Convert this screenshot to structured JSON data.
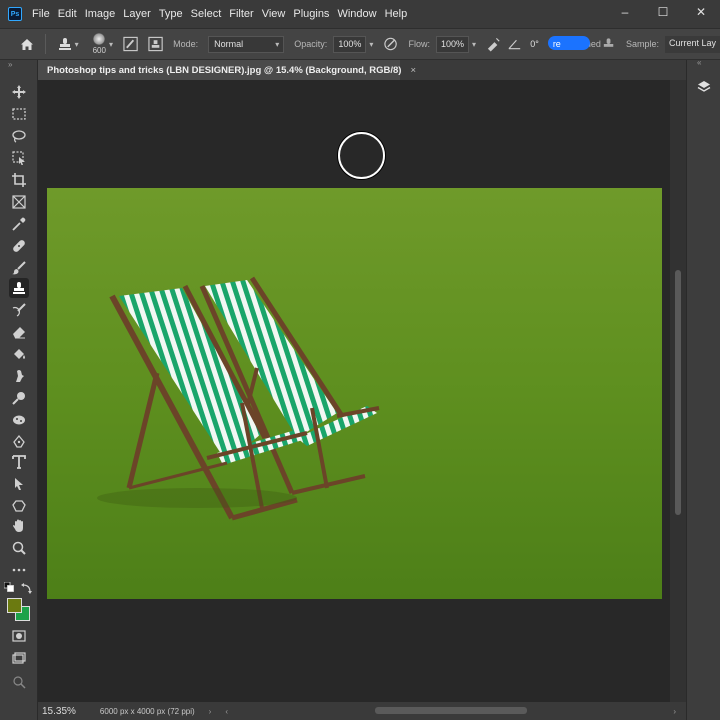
{
  "app": {
    "logo": "Ps"
  },
  "menu": [
    "File",
    "Edit",
    "Image",
    "Layer",
    "Type",
    "Select",
    "Filter",
    "View",
    "Plugins",
    "Window",
    "Help"
  ],
  "window_controls": {
    "minimize": "–",
    "maximize": "☐",
    "close": "✕"
  },
  "options": {
    "brush_size": "600",
    "mode_label": "Mode:",
    "mode_value": "Normal",
    "opacity_label": "Opacity:",
    "opacity_value": "100%",
    "flow_label": "Flow:",
    "flow_value": "100%",
    "angle_value": "0°",
    "angle_suffix": "re",
    "aligned_label": "Aligned",
    "sample_label": "Sample:",
    "sample_value": "Current Lay"
  },
  "document": {
    "tab_title": "Photoshop tips and tricks (LBN DESIGNER).jpg @ 15.4% (Background, RGB/8)",
    "tab_close": "×"
  },
  "status": {
    "zoom": "15.35%",
    "doc_info": "6000 px x 4000 px (72 ppi)"
  },
  "colors": {
    "foreground": "#6b7a10",
    "background": "#1ca24a",
    "accent": "#1b73ff"
  }
}
